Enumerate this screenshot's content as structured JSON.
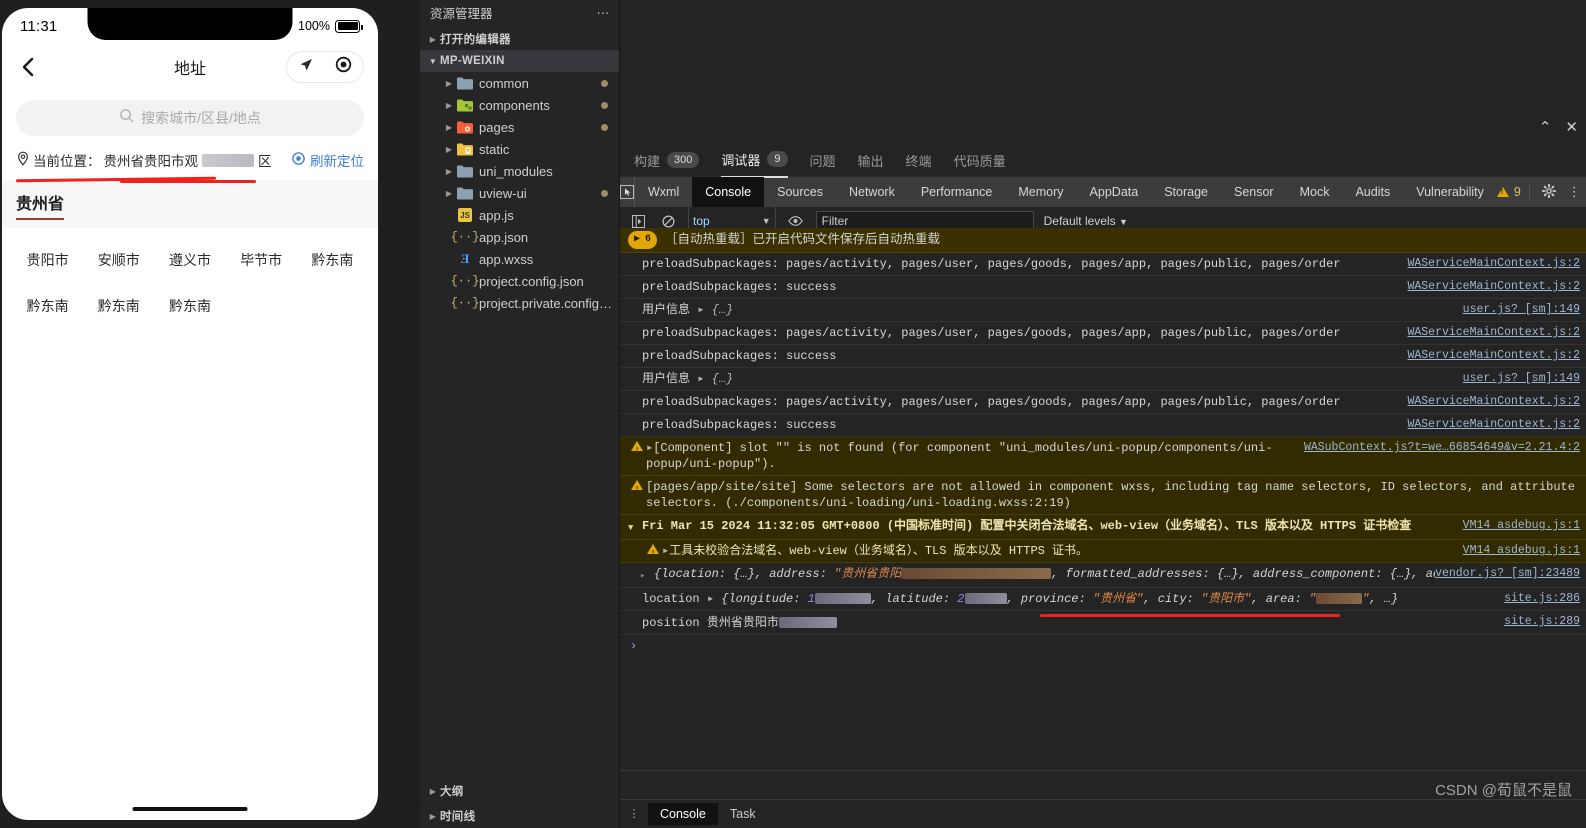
{
  "phone": {
    "status": {
      "time": "11:31",
      "battery_pct": "100%"
    },
    "nav": {
      "title": "地址",
      "back_icon": "chevron-left-icon",
      "locate_icon": "navigation-arrow-icon",
      "target_icon": "crosshair-target-icon"
    },
    "search": {
      "placeholder": "搜索城市/区县/地点",
      "icon": "search-icon"
    },
    "current_location": {
      "pin_icon": "map-pin-icon",
      "label": "当前位置：",
      "value": "贵州省贵阳市观",
      "suffix": "区",
      "refresh_label": "刷新定位",
      "refresh_icon": "target-icon"
    },
    "province": "贵州省",
    "cities": [
      "贵阳市",
      "安顺市",
      "遵义市",
      "毕节市",
      "黔东南",
      "黔东南",
      "黔东南",
      "黔东南"
    ]
  },
  "explorer": {
    "title": "资源管理器",
    "more_icon": "ellipsis-icon",
    "sections": [
      {
        "label": "打开的编辑器",
        "expanded": false
      },
      {
        "label": "MP-WEIXIN",
        "expanded": true
      }
    ],
    "folders": [
      {
        "label": "common",
        "icon": "folder-icon",
        "color": "#8ba0b0",
        "dot": true
      },
      {
        "label": "components",
        "icon": "folder-components-icon",
        "color": "#a6c639",
        "dot": true
      },
      {
        "label": "pages",
        "icon": "folder-pages-icon",
        "color": "#f4623a",
        "dot": true
      },
      {
        "label": "static",
        "icon": "folder-static-icon",
        "color": "#f0c040",
        "dot": false
      },
      {
        "label": "uni_modules",
        "icon": "folder-icon",
        "color": "#8ba0b0",
        "dot": false
      },
      {
        "label": "uview-ui",
        "icon": "folder-icon",
        "color": "#8ba0b0",
        "dot": true
      }
    ],
    "files": [
      {
        "label": "app.js",
        "icon": "js-file-icon"
      },
      {
        "label": "app.json",
        "icon": "json-file-icon"
      },
      {
        "label": "app.wxss",
        "icon": "css-file-icon"
      },
      {
        "label": "project.config.json",
        "icon": "json-file-icon"
      },
      {
        "label": "project.private.config.js...",
        "icon": "json-file-icon"
      }
    ],
    "bottom_sections": [
      {
        "label": "大纲"
      },
      {
        "label": "时间线"
      }
    ]
  },
  "devtools": {
    "window_controls": {
      "collapse_icon": "chevron-up-icon",
      "close_icon": "close-icon"
    },
    "panels": [
      {
        "label": "构建",
        "badge": "300",
        "active": false
      },
      {
        "label": "调试器",
        "badge": "9",
        "active": true
      },
      {
        "label": "问题",
        "badge": "",
        "active": false
      },
      {
        "label": "输出",
        "badge": "",
        "active": false
      },
      {
        "label": "终端",
        "badge": "",
        "active": false
      },
      {
        "label": "代码质量",
        "badge": "",
        "active": false
      }
    ],
    "cursor_icon": "inspect-element-icon",
    "tabs": [
      {
        "label": "Wxml",
        "active": false
      },
      {
        "label": "Console",
        "active": true
      },
      {
        "label": "Sources",
        "active": false
      },
      {
        "label": "Network",
        "active": false
      },
      {
        "label": "Performance",
        "active": false
      },
      {
        "label": "Memory",
        "active": false
      },
      {
        "label": "AppData",
        "active": false
      },
      {
        "label": "Storage",
        "active": false
      },
      {
        "label": "Sensor",
        "active": false
      },
      {
        "label": "Mock",
        "active": false
      },
      {
        "label": "Audits",
        "active": false
      },
      {
        "label": "Vulnerability",
        "active": false
      }
    ],
    "warning_count": "9",
    "settings_icon": "gear-icon",
    "overflow_icon": "kebab-menu-icon",
    "filterbar": {
      "execute_icon": "sidebar-toggle-icon",
      "clear_icon": "clear-console-icon",
      "context": "top",
      "context_arrow": "chevron-down-icon",
      "eye_icon": "eye-icon",
      "filter_placeholder": "Filter",
      "levels": "Default levels",
      "levels_arrow": "chevron-down-icon"
    },
    "console_rows": [
      {
        "type": "banner",
        "count": "6",
        "text": "［自动热重载］已开启代码文件保存后自动热重载",
        "src": ""
      },
      {
        "type": "log",
        "text": "preloadSubpackages: pages/activity, pages/user, pages/goods, pages/app, pages/public, pages/order",
        "src": "WAServiceMainContext.js:2"
      },
      {
        "type": "log",
        "text": "preloadSubpackages: success",
        "src": "WAServiceMainContext.js:2"
      },
      {
        "type": "object",
        "text": "用户信息",
        "obj": "{…}",
        "src": "user.js? [sm]:149"
      },
      {
        "type": "log",
        "text": "preloadSubpackages: pages/activity, pages/user, pages/goods, pages/app, pages/public, pages/order",
        "src": "WAServiceMainContext.js:2"
      },
      {
        "type": "log",
        "text": "preloadSubpackages: success",
        "src": "WAServiceMainContext.js:2"
      },
      {
        "type": "object",
        "text": "用户信息",
        "obj": "{…}",
        "src": "user.js? [sm]:149"
      },
      {
        "type": "log",
        "text": "preloadSubpackages: pages/activity, pages/user, pages/goods, pages/app, pages/public, pages/order",
        "src": "WAServiceMainContext.js:2"
      },
      {
        "type": "log",
        "text": "preloadSubpackages: success",
        "src": "WAServiceMainContext.js:2"
      }
    ],
    "warn_rows": [
      {
        "text": "[Component] slot \"\" is not found (for component \"uni_modules/uni-popup/components/uni-popup/uni-popup\").",
        "src": "WASubContext.js?t=we…66854649&v=2.21.4:2"
      },
      {
        "text": "[pages/app/site/site] Some selectors are not allowed in component wxss, including tag name selectors, ID selectors, and attribute selectors. (./components/uni-loading/uni-loading.wxss:2:19)",
        "src": ""
      }
    ],
    "group_row": {
      "text": "Fri Mar 15 2024 11:32:05 GMT+0800 (中国标准时间) 配置中关闭合法域名、web-view（业务域名）、TLS 版本以及 HTTPS 证书检查",
      "src": "VM14 asdebug.js:1"
    },
    "group_child": {
      "text": "工具未校验合法域名、web-view（业务域名）、TLS 版本以及 HTTPS 证书。",
      "src": "VM14 asdebug.js:1"
    },
    "result_rows": [
      {
        "label": "",
        "prefix": "{location: {…}, address: ",
        "string_val": "\"贵州省贵阳",
        "suffix": ", formatted_addresses: {…}, address_component: {…}, ad_info: {…}, …}",
        "src": "vendor.js? [sm]:23489"
      },
      {
        "label": "location",
        "prefix": "{longitude: ",
        "lng": "1",
        "mid": ", latitude: ",
        "lat": "2",
        "mid2": ", province: ",
        "province": "\"贵州省\"",
        "mid3": ", city: ",
        "city": "\"贵阳市\"",
        "mid4": ", area: ",
        "area": "\"",
        "tail": ", …}",
        "src": "site.js:286"
      },
      {
        "label": "position",
        "value": "贵州省贵阳市",
        "src": "site.js:289"
      }
    ],
    "prompt_symbol": "›",
    "bottom_tabs": [
      {
        "label": "Console",
        "active": true
      },
      {
        "label": "Task",
        "active": false
      }
    ],
    "bottom_dots_icon": "drag-handle-icon"
  },
  "watermark": "CSDN @荀鼠不是鼠"
}
